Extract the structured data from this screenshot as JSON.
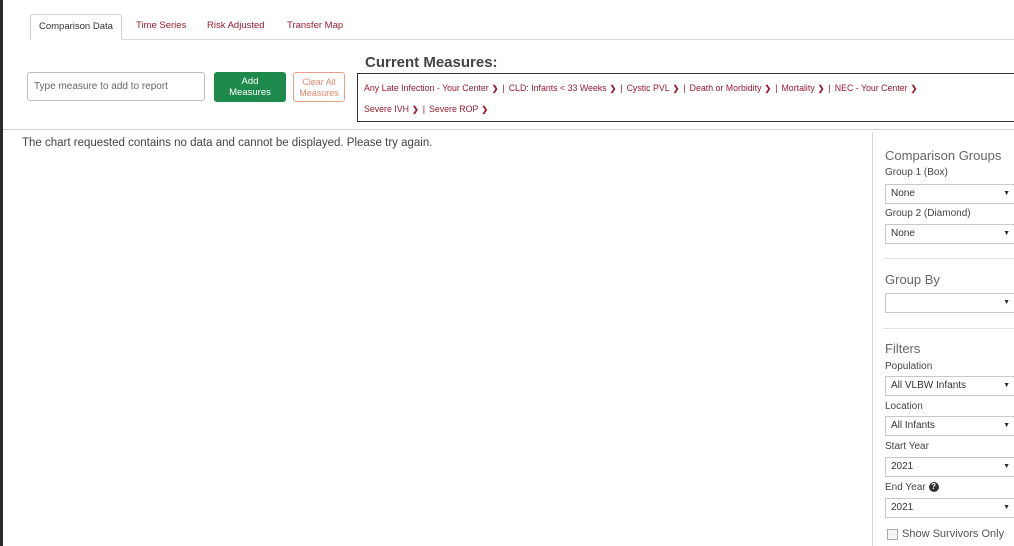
{
  "tabs": [
    {
      "label": "Comparison Data",
      "active": true
    },
    {
      "label": "Time Series",
      "active": false
    },
    {
      "label": "Risk Adjusted",
      "active": false
    },
    {
      "label": "Transfer Map",
      "active": false
    }
  ],
  "search": {
    "placeholder": "Type measure to add to report"
  },
  "buttons": {
    "add_line1": "Add",
    "add_line2": "Measures",
    "clear_line1": "Clear All",
    "clear_line2": "Measures"
  },
  "current_measures": {
    "title": "Current Measures:",
    "line1": [
      "Any Late Infection - Your Center",
      "CLD: Infants < 33 Weeks",
      "Cystic PVL",
      "Death or Morbidity",
      "Mortality",
      "NEC - Your Center"
    ],
    "line2": [
      "Severe IVH",
      "Severe ROP"
    ]
  },
  "message": "The chart requested contains no data and cannot be displayed. Please try again.",
  "panel": {
    "comparison_groups_title": "Comparison Groups",
    "group1_label": "Group 1 (Box)",
    "group1_value": "None",
    "group2_label": "Group 2 (Diamond)",
    "group2_value": "None",
    "group_by_title": "Group By",
    "group_by_value": "",
    "filters_title": "Filters",
    "population_label": "Population",
    "population_value": "All VLBW Infants",
    "location_label": "Location",
    "location_value": "All Infants",
    "start_year_label": "Start Year",
    "start_year_value": "2021",
    "end_year_label": "End Year",
    "end_year_value": "2021",
    "show_survivors_label": "Show Survivors Only"
  },
  "colors": {
    "accent": "#9b1b30",
    "add_button": "#1e8a4c",
    "clear_button": "#e08a6e"
  },
  "icons": {
    "chevron": "chevron-down-icon",
    "caret": "caret-down-icon",
    "help": "help-icon"
  }
}
